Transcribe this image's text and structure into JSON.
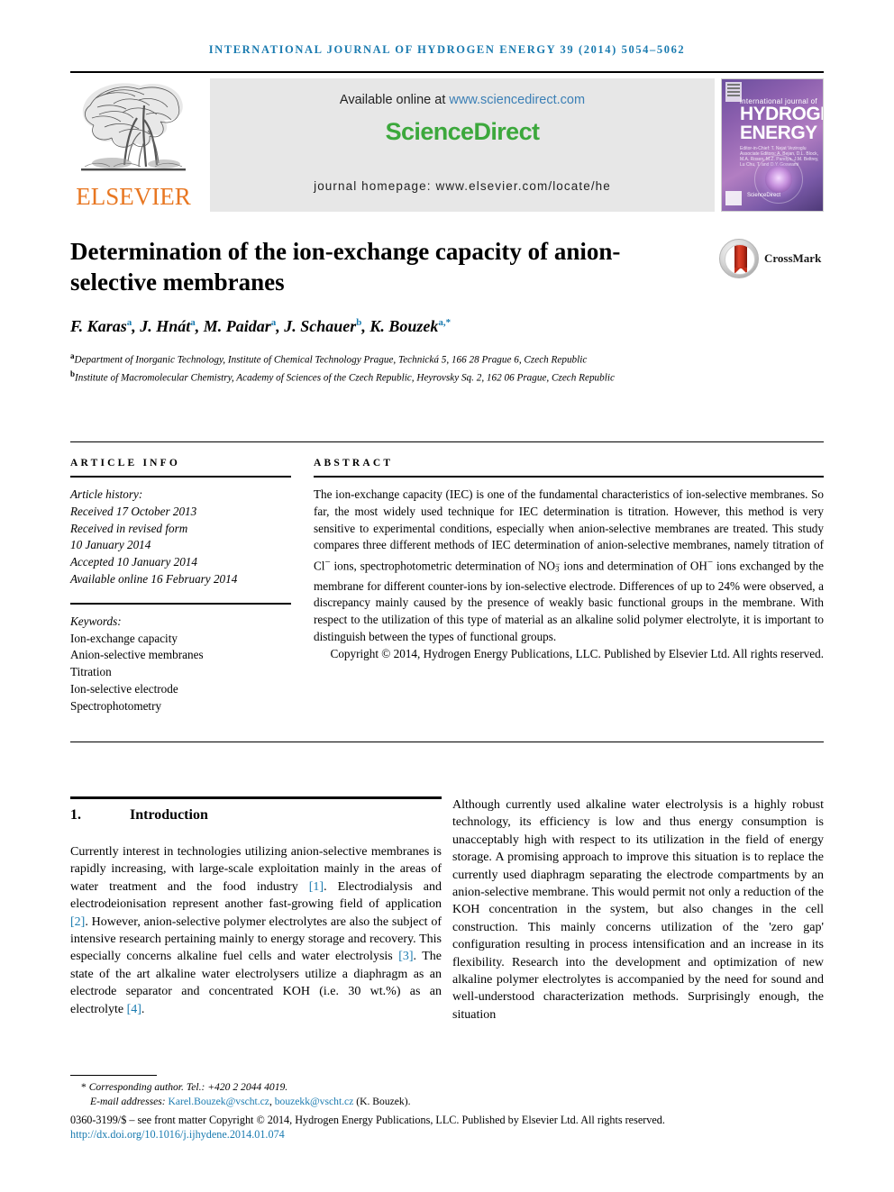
{
  "running_head": "INTERNATIONAL JOURNAL OF HYDROGEN ENERGY 39 (2014) 5054–5062",
  "banner": {
    "publisher": "ELSEVIER",
    "available_prefix": "Available online at ",
    "available_link": "www.sciencedirect.com",
    "sciencedirect_logo": "ScienceDirect",
    "journal_homepage": "journal homepage: www.elsevier.com/locate/he",
    "cover": {
      "line1": "international journal of",
      "title1": "HYDROGEN",
      "title2": "ENERGY",
      "editors": "Editor-in-Chief: T. Nejat Veziroglu\nAssociate Editors: A. Bejan, D.L. Block, M.A. Rosen, M.Z. Pandya, J.M. Beltrey, Lu Chu, T. and D.Y. Goswami",
      "sciencedirect": "ScienceDirect"
    }
  },
  "article": {
    "title": "Determination of the ion-exchange capacity of anion-selective membranes",
    "crossmark_label": "CrossMark",
    "authors": [
      {
        "name": "F. Karas",
        "marks": "a",
        "sep": ", "
      },
      {
        "name": "J. Hnát",
        "marks": "a",
        "sep": ", "
      },
      {
        "name": "M. Paidar",
        "marks": "a",
        "sep": ", "
      },
      {
        "name": "J. Schauer",
        "marks": "b",
        "sep": ", "
      },
      {
        "name": "K. Bouzek",
        "marks": "a,*",
        "sep": ""
      }
    ],
    "affiliations": [
      {
        "mark": "a",
        "text": "Department of Inorganic Technology, Institute of Chemical Technology Prague, Technická 5, 166 28 Prague 6, Czech Republic"
      },
      {
        "mark": "b",
        "text": "Institute of Macromolecular Chemistry, Academy of Sciences of the Czech Republic, Heyrovsky Sq. 2, 162 06 Prague, Czech Republic"
      }
    ]
  },
  "article_info": {
    "heading": "ARTICLE INFO",
    "history_label": "Article history:",
    "history": [
      "Received 17 October 2013",
      "Received in revised form",
      "10 January 2014",
      "Accepted 10 January 2014",
      "Available online 16 February 2014"
    ],
    "keywords_label": "Keywords:",
    "keywords": [
      "Ion-exchange capacity",
      "Anion-selective membranes",
      "Titration",
      "Ion-selective electrode",
      "Spectrophotometry"
    ]
  },
  "abstract": {
    "heading": "ABSTRACT",
    "part1": "The ion-exchange capacity (IEC) is one of the fundamental characteristics of ion-selective membranes. So far, the most widely used technique for IEC determination is titration. However, this method is very sensitive to experimental conditions, especially when anion-selective membranes are treated. This study compares three different methods of IEC determination of anion-selective membranes, namely titration of Cl",
    "sup1": "−",
    "part2": " ions, spectrophotometric determination of NO",
    "sub1": "3",
    "sup2": "−",
    "part3": " ions and determination of OH",
    "sup3": "−",
    "part4": " ions exchanged by the membrane for different counter-ions by ion-selective electrode. Differences of up to 24% were observed, a discrepancy mainly caused by the presence of weakly basic functional groups in the membrane. With respect to the utilization of this type of material as an alkaline solid polymer electrolyte, it is important to distinguish between the types of functional groups.",
    "copyright": "Copyright © 2014, Hydrogen Energy Publications, LLC. Published by Elsevier Ltd. All rights reserved."
  },
  "introduction": {
    "number": "1.",
    "title": "Introduction",
    "left_part1": "Currently interest in technologies utilizing anion-selective membranes is rapidly increasing, with large-scale exploitation mainly in the areas of water treatment and the food industry ",
    "ref1": "[1]",
    "left_part2": ". Electrodialysis and electrodeionisation represent another fast-growing field of application ",
    "ref2": "[2]",
    "left_part3": ". However, anion-selective polymer electrolytes are also the subject of intensive research pertaining mainly to energy storage and recovery. This especially concerns alkaline fuel cells and water electrolysis ",
    "ref3": "[3]",
    "left_part4": ". The state of the art alkaline water electrolysers utilize a diaphragm as an electrode separator and concentrated KOH (i.e. 30 wt.%) as an electrolyte ",
    "ref4": "[4]",
    "left_part5": ".",
    "right_text": "Although currently used alkaline water electrolysis is a highly robust technology, its efficiency is low and thus energy consumption is unacceptably high with respect to its utilization in the field of energy storage. A promising approach to improve this situation is to replace the currently used diaphragm separating the electrode compartments by an anion-selective membrane. This would permit not only a reduction of the KOH concentration in the system, but also changes in the cell construction. This mainly concerns utilization of the 'zero gap' configuration resulting in process intensification and an increase in its flexibility. Research into the development and optimization of new alkaline polymer electrolytes is accompanied by the need for sound and well-understood characterization methods. Surprisingly enough, the situation"
  },
  "footer": {
    "corresponding_marker": "*",
    "corresponding": "Corresponding author. Tel.: +420 2 2044 4019.",
    "email_label": "E-mail addresses:",
    "email1": "Karel.Bouzek@vscht.cz",
    "email_sep": ", ",
    "email2": "bouzekk@vscht.cz",
    "email_suffix": " (K. Bouzek).",
    "issn": "0360-3199/$ – see front matter Copyright © 2014, Hydrogen Energy Publications, LLC. Published by Elsevier Ltd. All rights reserved.",
    "doi": "http://dx.doi.org/10.1016/j.ijhydene.2014.01.074"
  },
  "colors": {
    "link": "#1a7bb0",
    "elsevier_orange": "#E87722",
    "sciencedirect_green": "#3CA83C",
    "header_blue": "#1a7bb0"
  }
}
